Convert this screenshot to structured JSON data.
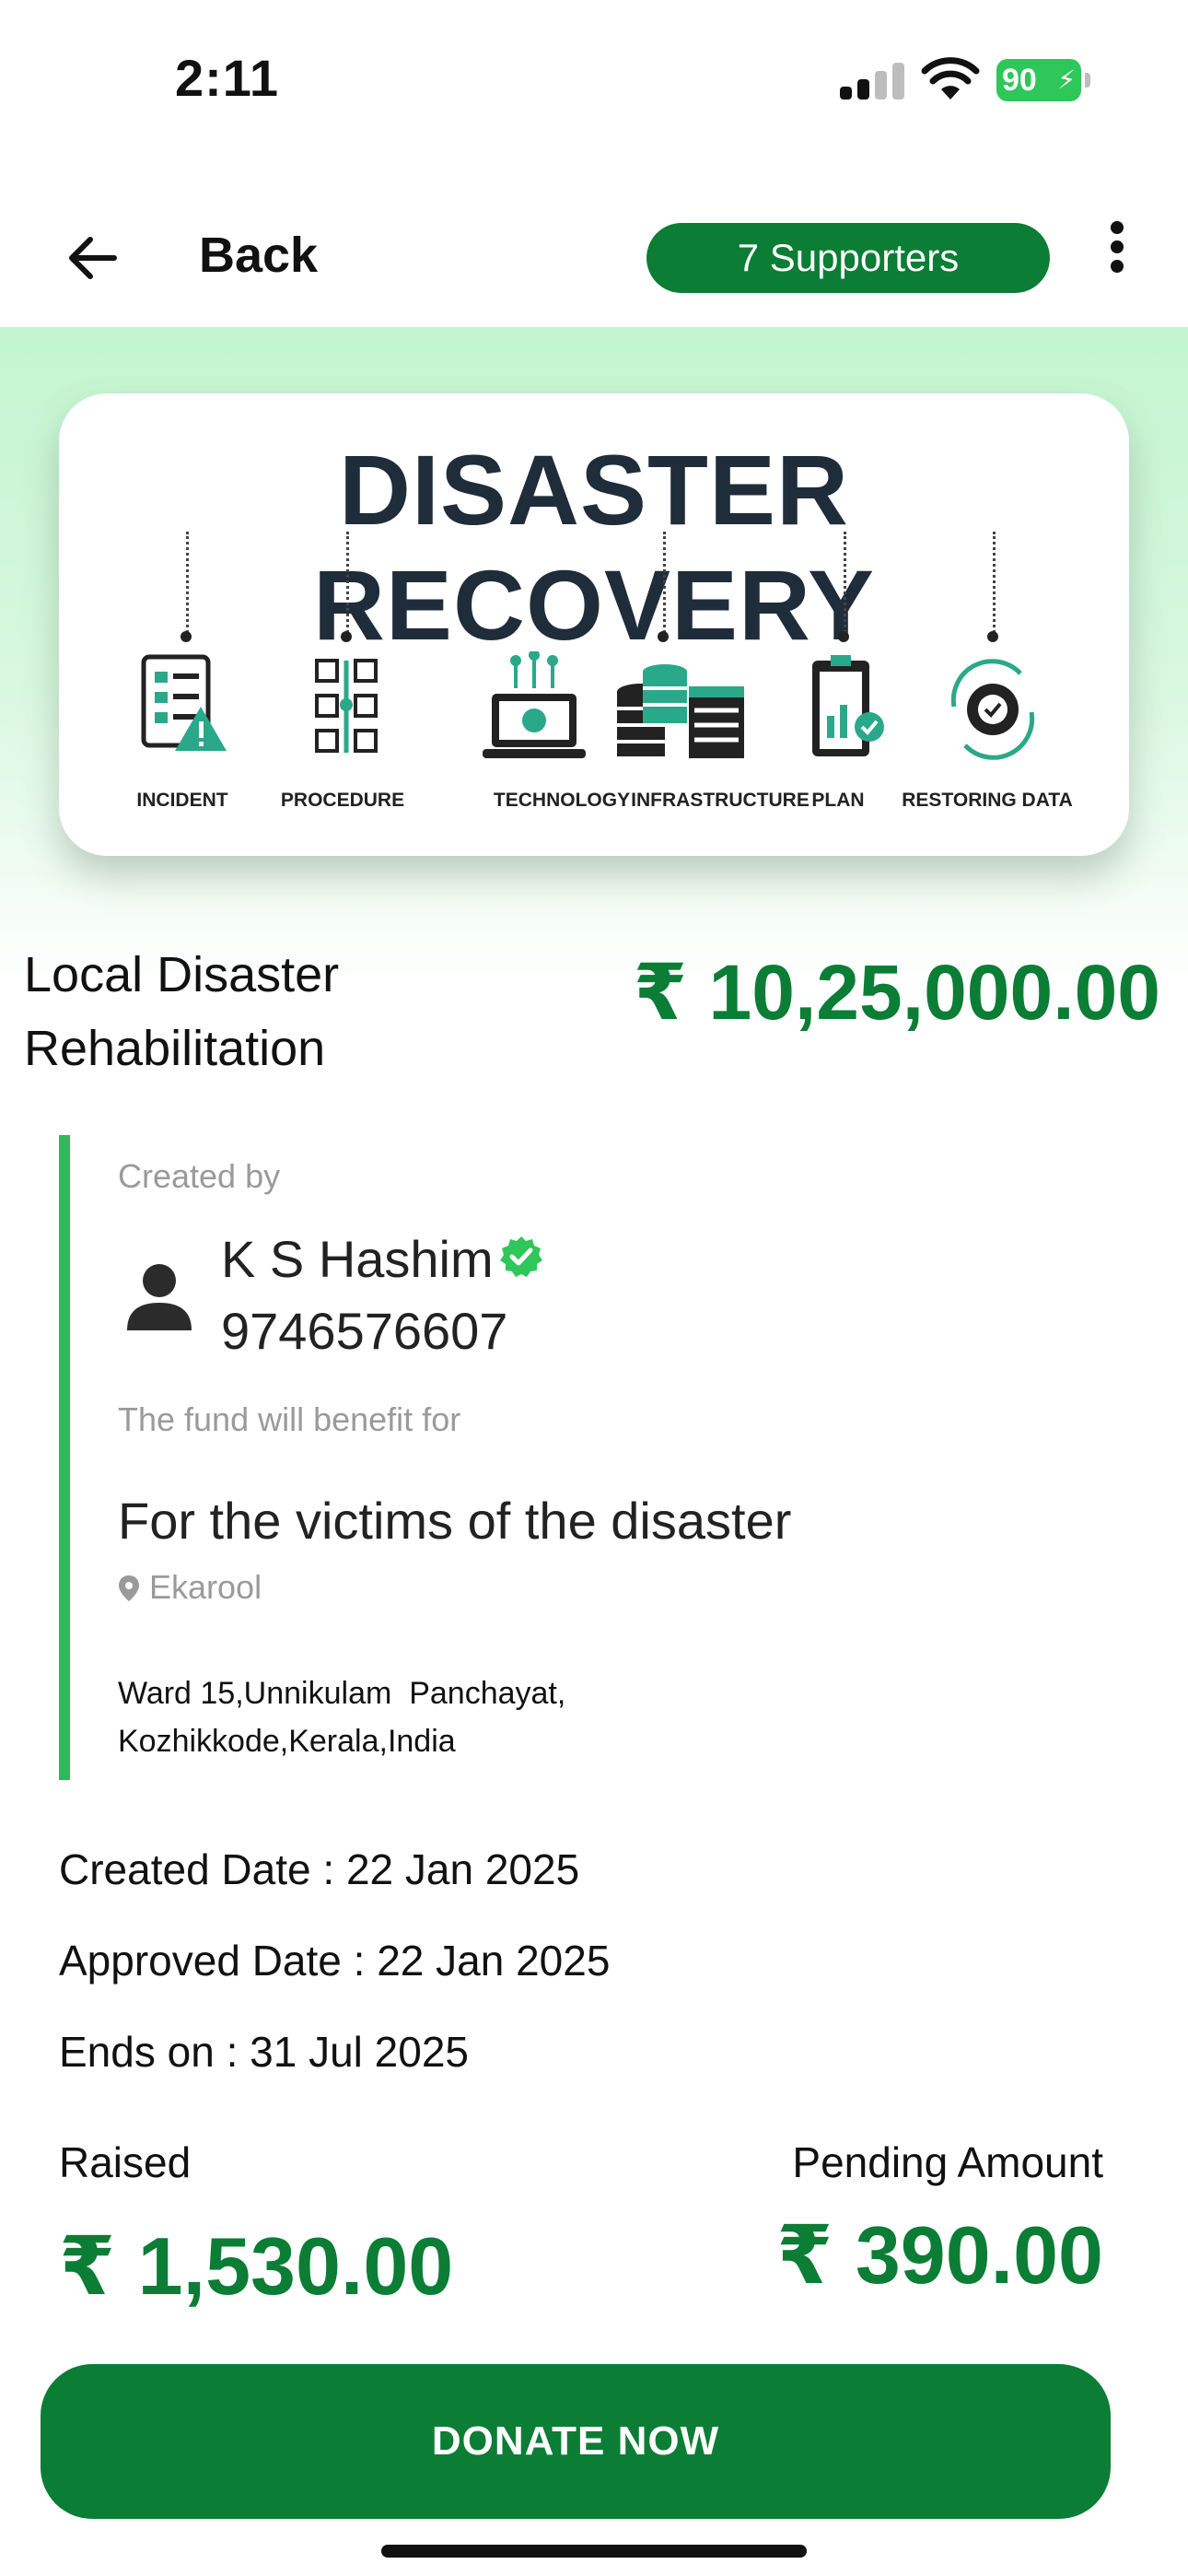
{
  "status_bar": {
    "time": "2:11",
    "battery": "90"
  },
  "nav": {
    "back_label": "Back",
    "supporters": "7 Supporters"
  },
  "banner": {
    "title": "DISASTER RECOVERY",
    "steps": [
      "INCIDENT",
      "PROCEDURE",
      "TECHNOLOGY",
      "INFRASTRUCTURE",
      "PLAN",
      "RESTORING DATA"
    ]
  },
  "campaign": {
    "title": "Local Disaster Rehabilitation",
    "goal": "₹ 10,25,000.00"
  },
  "creator": {
    "label": "Created by",
    "name": "K S Hashim",
    "phone": "9746576607"
  },
  "benefit": {
    "label": "The fund will benefit for",
    "beneficiary": "For the victims of the disaster",
    "location": "Ekarool",
    "address_line1": "Ward 15,Unnikulam  Panchayat,",
    "address_line2": "Kozhikkode,Kerala,India"
  },
  "dates": {
    "created": "Created Date : 22 Jan 2025",
    "approved": "Approved Date : 22 Jan 2025",
    "ends": "Ends on : 31 Jul 2025"
  },
  "amounts": {
    "raised_label": "Raised",
    "raised_value": "₹ 1,530.00",
    "pending_label": "Pending Amount",
    "pending_value": "₹ 390.00"
  },
  "actions": {
    "donate_label": "DONATE NOW"
  },
  "icons": [
    "back-arrow-icon",
    "more-vertical-icon",
    "user-icon",
    "verified-check-icon",
    "location-pin-icon",
    "wifi-icon",
    "signal-icon",
    "battery-icon"
  ],
  "colors": {
    "primary": "#0b7d35",
    "accent_border": "#2eb85c",
    "hero_bg": "#c3f5d0",
    "verified": "#2fc65a"
  }
}
